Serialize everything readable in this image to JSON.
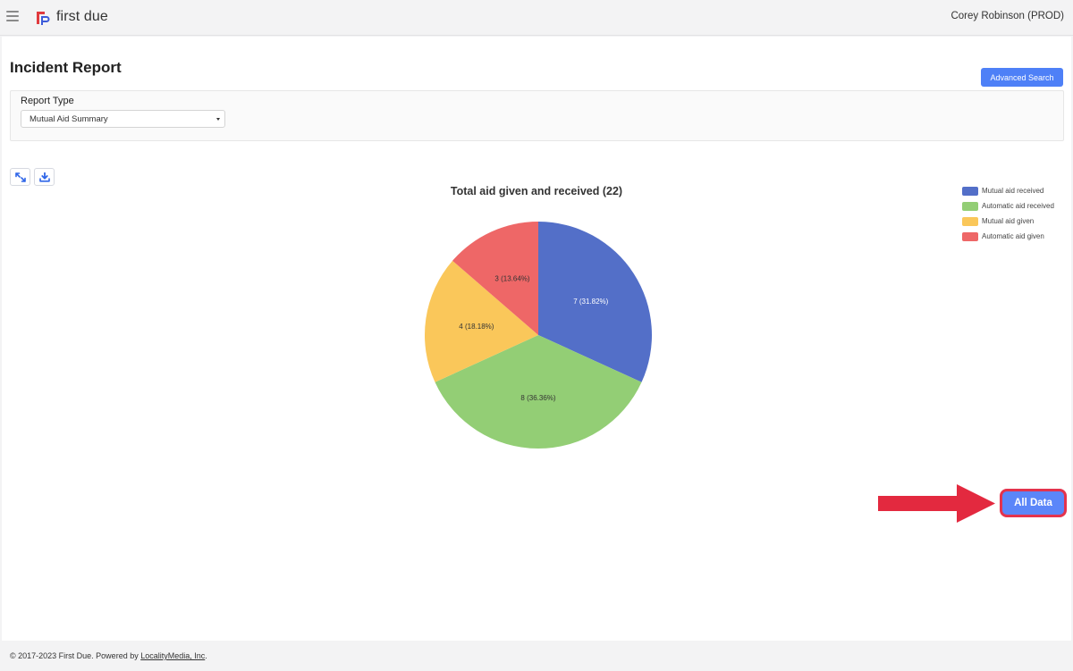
{
  "app": {
    "brand_name": "first due",
    "user_label": "Corey Robinson (PROD)"
  },
  "page": {
    "title": "Incident Report",
    "advanced_search_label": "Advanced Search"
  },
  "filters": {
    "report_type_label": "Report Type",
    "report_type_value": "Mutual Aid Summary"
  },
  "toolbar": {
    "expand_icon": "expand-arrows-icon",
    "download_icon": "download-icon"
  },
  "chart_data": {
    "type": "pie",
    "title": "Total aid given and received (22)",
    "categories": [
      "Mutual aid received",
      "Automatic aid received",
      "Mutual aid given",
      "Automatic aid given"
    ],
    "values": [
      7,
      8,
      4,
      3
    ],
    "slice_labels": [
      "7 (31.82%)",
      "8 (36.36%)",
      "4 (18.18%)",
      "3 (13.64%)"
    ],
    "colors": [
      "#536fc8",
      "#93ce75",
      "#fac75a",
      "#ee6767"
    ],
    "legend_position": "top-right"
  },
  "actions": {
    "all_data_label": "All Data",
    "highlight_color": "#e4334d"
  },
  "footer": {
    "prefix": "© 2017-2023 First Due. Powered by ",
    "link_text": "LocalityMedia, Inc",
    "suffix": "."
  }
}
